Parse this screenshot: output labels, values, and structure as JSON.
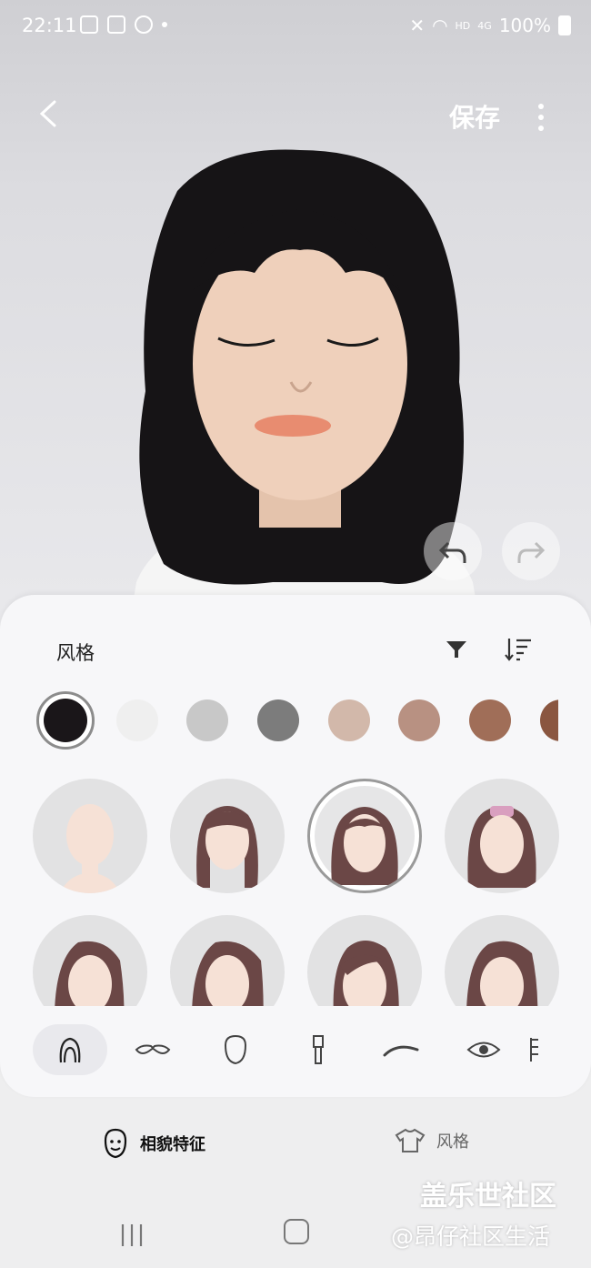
{
  "status_bar": {
    "time": "22:11",
    "hd": "HD",
    "network": "4G",
    "battery": "100%"
  },
  "header": {
    "save_label": "保存"
  },
  "panel": {
    "title": "风格",
    "colors": [
      "#1a1619",
      "#efefef",
      "#c8c8c8",
      "#7c7c7c",
      "#d2b8aa",
      "#b89182",
      "#a06e58",
      "#8a5640"
    ]
  },
  "tabs": [
    {
      "label": "相貌特征"
    },
    {
      "label": "风格"
    }
  ],
  "watermark": {
    "line1": "盖乐世社区",
    "line2": "@昂仔社区生活"
  }
}
